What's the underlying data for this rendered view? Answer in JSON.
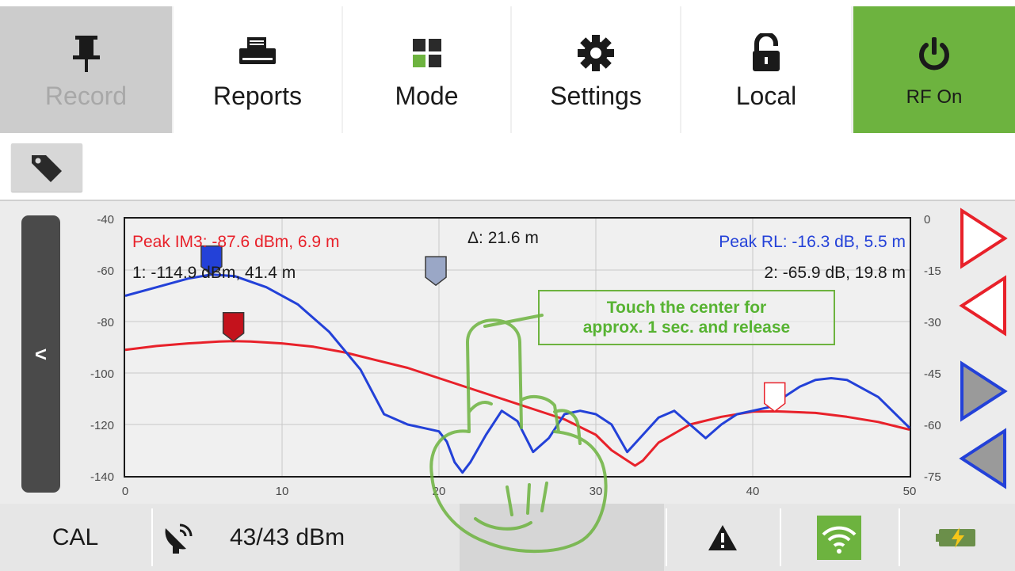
{
  "toolbar": {
    "record_label": "Record",
    "reports_label": "Reports",
    "mode_label": "Mode",
    "settings_label": "Settings",
    "local_label": "Local",
    "rf_on_label": "RF On"
  },
  "colors": {
    "accent_green": "#6db33f",
    "im3_red": "#e8212a",
    "rl_blue": "#2341d8",
    "tip_green": "#57b332"
  },
  "icons": {
    "record": "pushpin-icon",
    "reports": "printer-icon",
    "mode": "grid-icon",
    "settings": "gear-icon",
    "local": "unlock-icon",
    "rf_on": "power-icon",
    "tag": "tag-icon",
    "antenna": "satellite-dish-icon",
    "warning": "warning-icon",
    "wifi": "wifi-icon",
    "battery": "battery-charging-icon"
  },
  "chart": {
    "readouts": {
      "peak_im3": "Peak IM3: -87.6 dBm, 6.9 m",
      "marker1": "1: -114.9 dBm, 41.4 m",
      "delta": "Δ: 21.6 m",
      "peak_rl": "Peak RL: -16.3 dB, 5.5 m",
      "marker2": "2: -65.9 dB, 19.8 m"
    },
    "tip_line1": "Touch the center for",
    "tip_line2": "approx. 1 sec. and release"
  },
  "chart_data": {
    "type": "line",
    "xlim": [
      0,
      50
    ],
    "ylim": [
      -140,
      -40
    ],
    "y2lim": [
      -75,
      0
    ],
    "x_ticks": [
      "0",
      "10",
      "20",
      "30",
      "40",
      "50"
    ],
    "y_ticks": [
      "-40",
      "-60",
      "-80",
      "-100",
      "-120",
      "-140"
    ],
    "y2_ticks": [
      "0",
      "-15",
      "-30",
      "-45",
      "-60",
      "-75"
    ],
    "grid": true,
    "series": [
      {
        "name": "Peak IM3",
        "color": "#e8212a",
        "axis": "left",
        "x": [
          0,
          2,
          4,
          6,
          6.9,
          8,
          10,
          12,
          14,
          16,
          18,
          20,
          22,
          24,
          26,
          28,
          30,
          31,
          32,
          32.5,
          33,
          34,
          36,
          38,
          40,
          41.4,
          42,
          44,
          46,
          48,
          50
        ],
        "y": [
          -91,
          -89.5,
          -88.5,
          -87.8,
          -87.6,
          -87.8,
          -88.5,
          -89.8,
          -92,
          -95,
          -98,
          -102,
          -106,
          -110,
          -114,
          -118,
          -124,
          -130,
          -134,
          -136,
          -134,
          -127,
          -120,
          -117,
          -115,
          -114.9,
          -115,
          -115.5,
          -117,
          -119,
          -122
        ]
      },
      {
        "name": "Peak RL",
        "color": "#2341d8",
        "axis": "right",
        "x": [
          0,
          2,
          4,
          5.5,
          7,
          9,
          11,
          13,
          15,
          16.5,
          18,
          19,
          20,
          20.5,
          21,
          21.5,
          22,
          23,
          24,
          25,
          26,
          27,
          28,
          29,
          30,
          31,
          32,
          33,
          34,
          35,
          36,
          37,
          38,
          39,
          40,
          41,
          42,
          43,
          44,
          45,
          46,
          48,
          50
        ],
        "y": [
          -22.5,
          -20,
          -17.5,
          -16.3,
          -16.8,
          -20,
          -25,
          -33,
          -44,
          -57,
          -60,
          -61,
          -62,
          -65,
          -71,
          -74,
          -71,
          -63,
          -56,
          -59,
          -68,
          -64,
          -57,
          -56,
          -57,
          -60,
          -68,
          -63,
          -58,
          -56,
          -60,
          -64,
          -60,
          -57,
          -56,
          -55,
          -52,
          -49,
          -47,
          -46.5,
          -47,
          -52,
          -61
        ]
      }
    ],
    "markers": [
      {
        "id": "peak-rl",
        "x": 5.5,
        "y": -16.3,
        "axis": "right",
        "color": "#2341d8"
      },
      {
        "id": "peak-im3",
        "x": 6.9,
        "y": -87.6,
        "axis": "left",
        "color": "#c4121c"
      },
      {
        "id": "marker-2",
        "x": 19.8,
        "y": -65.9,
        "axis": "left",
        "color": "#9aa7c6"
      },
      {
        "id": "marker-1",
        "x": 41.4,
        "y": -114.9,
        "axis": "left",
        "color": "#ffffff"
      }
    ]
  },
  "statusbar": {
    "cal_label": "CAL",
    "power_reading": "43/43 dBm"
  }
}
